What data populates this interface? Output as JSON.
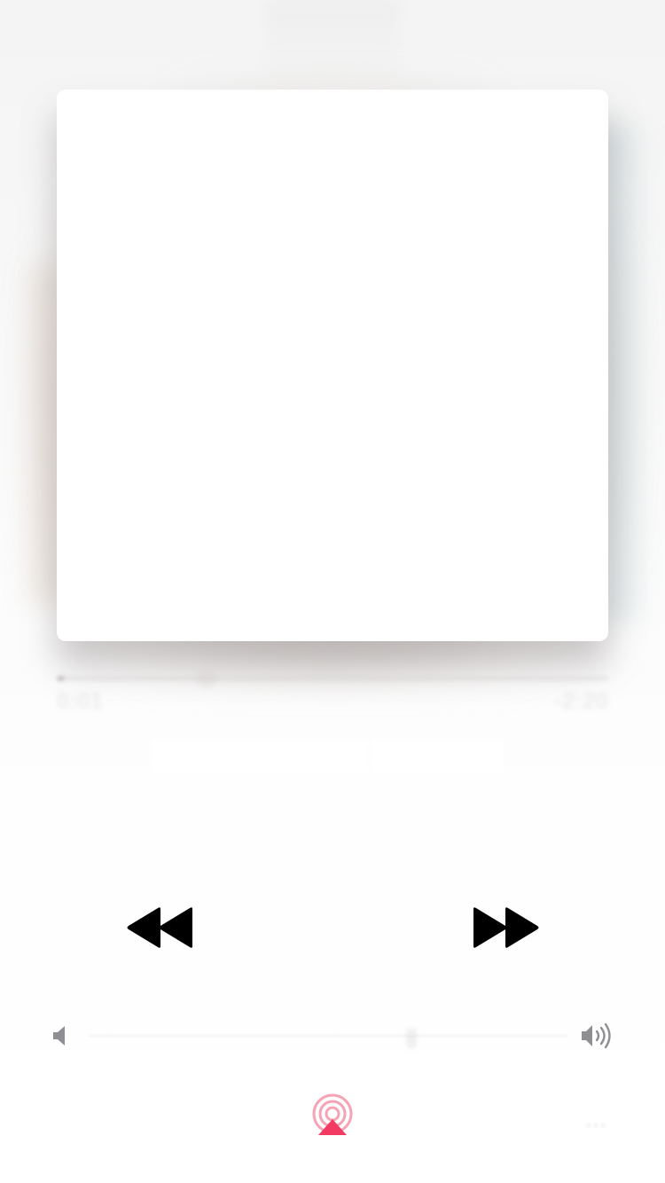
{
  "player": {
    "title": "",
    "artist": "",
    "time_elapsed": "0:01",
    "time_remaining": "-2:20",
    "progress": 0.015,
    "volume": 0.68
  },
  "icons": {
    "rewind": "rewind-icon",
    "play": "play-icon",
    "fast_forward": "fast-forward-icon",
    "volume_min": "speaker-low-icon",
    "volume_max": "speaker-high-icon",
    "airplay": "airplay-icon",
    "more": "ellipsis-icon"
  },
  "colors": {
    "accent": "#f23a63",
    "control": "#000000",
    "volume_icon": "#8e8e93"
  }
}
